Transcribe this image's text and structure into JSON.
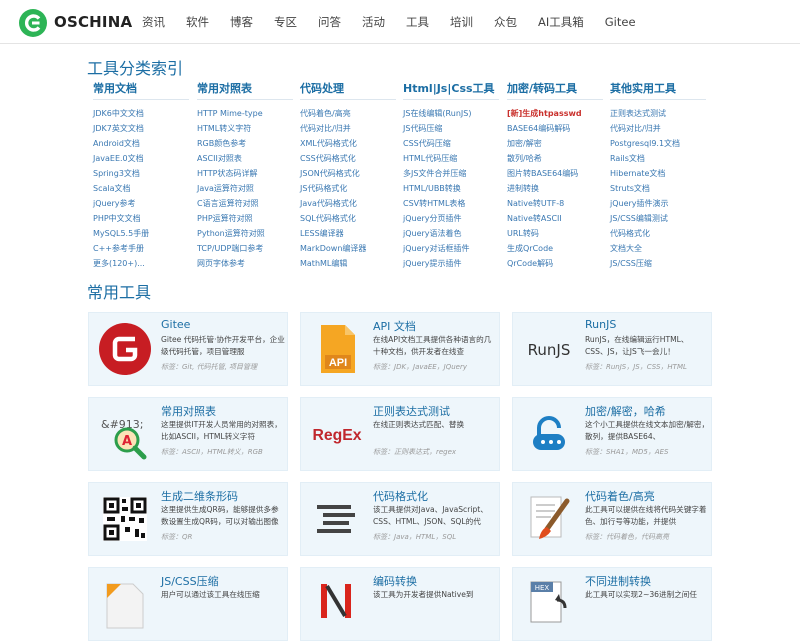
{
  "header": {
    "logo_text": "OSCHINA",
    "nav": [
      "资讯",
      "软件",
      "博客",
      "专区",
      "问答",
      "活动",
      "工具",
      "培训",
      "众包",
      "AI工具箱",
      "Gitee"
    ]
  },
  "index": {
    "title": "工具分类索引",
    "columns": [
      {
        "head": "常用文档",
        "links": [
          "JDK6中文文档",
          "JDK7英文文档",
          "Android文档",
          "JavaEE.0文档",
          "Spring3文档",
          "Scala文档",
          "jQuery参考",
          "PHP中文文档",
          "MySQL5.5手册",
          "C++参考手册",
          "更多(120+)..."
        ]
      },
      {
        "head": "常用对照表",
        "links": [
          "HTTP Mime-type",
          "HTML转义字符",
          "RGB颜色参考",
          "ASCII对照表",
          "HTTP状态码详解",
          "Java运算符对照",
          "C语言运算符对照",
          "PHP运算符对照",
          "Python运算符对照",
          "TCP/UDP端口参考",
          "网页字体参考"
        ]
      },
      {
        "head": "代码处理",
        "links": [
          "代码着色/高亮",
          "代码对比/归并",
          "XML代码格式化",
          "CSS代码格式化",
          "JSON代码格式化",
          "JS代码格式化",
          "Java代码格式化",
          "SQL代码格式化",
          "LESS编译器",
          "MarkDown编译器",
          "MathML编辑"
        ]
      },
      {
        "head": "Html|Js|Css工具",
        "links": [
          "JS在线编辑(RunJS)",
          "JS代码压缩",
          "CSS代码压缩",
          "HTML代码压缩",
          "多JS文件合并压缩",
          "HTML/UBB转换",
          "CSV转HTML表格",
          "jQuery分页插件",
          "jQuery语法着色",
          "jQuery对话框插件",
          "jQuery提示插件"
        ]
      },
      {
        "head": "加密/转码工具",
        "links": [
          "[新]生成htpasswd",
          "BASE64编码解码",
          "加密/解密",
          "散列/哈希",
          "图片转BASE64编码",
          "进制转换",
          "Native转UTF-8",
          "Native转ASCII",
          "URL转码",
          "生成QrCode",
          "QrCode解码"
        ]
      },
      {
        "head": "其他实用工具",
        "links": [
          "正则表达式测试",
          "代码对比/归并",
          "Postgresql9.1文档",
          "Rails文档",
          "Hibernate文档",
          "Struts文档",
          "jQuery插件演示",
          "JS/CSS编辑测试",
          "代码格式化",
          "文档大全",
          "JS/CSS压缩"
        ]
      }
    ]
  },
  "tools": {
    "title": "常用工具",
    "cards": [
      {
        "title": "Gitee",
        "desc": "Gitee 代码托管·协作开发平台，企业级代码托管，项目管理服",
        "tags": "标签：Git, 代码托管, 项目管理",
        "icon": "gitee-icon"
      },
      {
        "title": "API 文档",
        "desc": "在线API文档工具提供各种语言的几十种文档，供开发者在线查",
        "tags": "标签：JDK，JavaEE，JQuery",
        "icon": "api-doc-icon",
        "icon_text": "API"
      },
      {
        "title": "RunJS",
        "desc": "RunJS，在线编辑运行HTML、CSS、JS，让JS飞一会儿！",
        "tags": "标签：RunJS，JS，CSS，HTML",
        "icon": "runjs-icon",
        "icon_text": "RunJS"
      },
      {
        "title": "常用对照表",
        "desc": "这里提供IT开发人员常用的对照表，比如ASCII，HTML转义字符",
        "tags": "标签：ASCII，HTML转义，RGB",
        "icon": "reference-table-icon",
        "icon_text": "&#913;"
      },
      {
        "title": "正则表达式测试",
        "desc": "在线正则表达式匹配、替换",
        "tags": "标签：正则表达式，regex",
        "icon": "regex-icon",
        "icon_text": "RegEx"
      },
      {
        "title": "加密/解密，哈希",
        "desc": "这个小工具提供在线文本加密/解密，散列，提供BASE64、",
        "tags": "标签：SHA1，MD5，AES",
        "icon": "lock-icon"
      },
      {
        "title": "生成二维条形码",
        "desc": "这里提供生成QR码，能够提供多参数设置生成QR码，可以对输出图像",
        "tags": "标签：QR",
        "icon": "qrcode-icon"
      },
      {
        "title": "代码格式化",
        "desc": "该工具提供对Java、JavaScript、CSS、HTML、JSON、SQL的代",
        "tags": "标签：Java，HTML，SQL",
        "icon": "code-format-icon"
      },
      {
        "title": "代码着色/高亮",
        "desc": "此工具可以提供在线将代码关键字着色、加行号等功能，并提供",
        "tags": "标签：代码着色，代码高亮",
        "icon": "brush-icon"
      },
      {
        "title": "JS/CSS压缩",
        "desc": "用户可以通过该工具在线压缩",
        "tags": "",
        "icon": "compress-icon"
      },
      {
        "title": "编码转换",
        "desc": "该工具为开发者提供Native到",
        "tags": "",
        "icon": "encoding-icon"
      },
      {
        "title": "不同进制转换",
        "desc": "此工具可以实现2~36进制之间任",
        "tags": "",
        "icon": "radix-icon",
        "icon_text": "HEX"
      }
    ]
  },
  "colors": {
    "brand_green": "#2db456",
    "link_blue": "#1c6ea4",
    "card_bg": "#eef6fb",
    "regex_red": "#c0272d",
    "regex_blue": "#1f3d8a"
  }
}
